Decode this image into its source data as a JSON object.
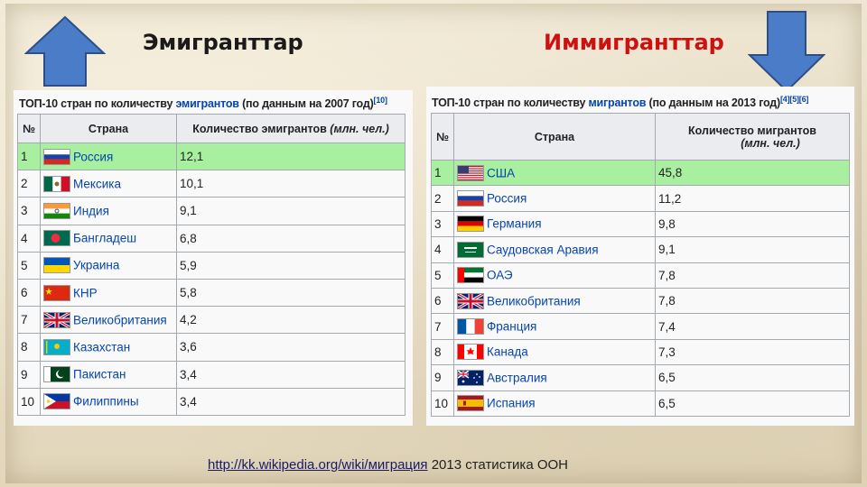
{
  "headings": {
    "left": "Эмигранттар",
    "right": "Иммигранттар"
  },
  "colors": {
    "arrow_fill": "#4a7cc7",
    "arrow_stroke": "#2d4f86",
    "highlight_row": "#a8f0a0",
    "link": "#0645ad",
    "right_heading": "#cc1111"
  },
  "left_table": {
    "caption_pre": "ТОП-10 стран по количеству",
    "caption_link": "эмигрантов",
    "caption_post": "(по данным на 2007 год)",
    "caption_ref": "[10]",
    "col_num": "№",
    "col_country": "Страна",
    "col_value": "Количество эмигрантов",
    "col_value_unit": "(млн. чел.)",
    "rows": [
      {
        "n": "1",
        "country": "Россия",
        "value": "12,1",
        "flag": "russia"
      },
      {
        "n": "2",
        "country": "Мексика",
        "value": "10,1",
        "flag": "mexico"
      },
      {
        "n": "3",
        "country": "Индия",
        "value": "9,1",
        "flag": "india"
      },
      {
        "n": "4",
        "country": "Бангладеш",
        "value": "6,8",
        "flag": "bangladesh"
      },
      {
        "n": "5",
        "country": "Украина",
        "value": "5,9",
        "flag": "ukraine"
      },
      {
        "n": "6",
        "country": "КНР",
        "value": "5,8",
        "flag": "china"
      },
      {
        "n": "7",
        "country": "Великобритания",
        "value": "4,2",
        "flag": "uk"
      },
      {
        "n": "8",
        "country": "Казахстан",
        "value": "3,6",
        "flag": "kazakhstan"
      },
      {
        "n": "9",
        "country": "Пакистан",
        "value": "3,4",
        "flag": "pakistan"
      },
      {
        "n": "10",
        "country": "Филиппины",
        "value": "3,4",
        "flag": "philippines"
      }
    ]
  },
  "right_table": {
    "caption_pre": "ТОП-10 стран по количеству",
    "caption_link": "мигрантов",
    "caption_post": "(по данным на 2013 год)",
    "caption_ref": "[4][5][6]",
    "col_num": "№",
    "col_country": "Страна",
    "col_value": "Количество мигрантов",
    "col_value_unit": "(млн. чел.)",
    "rows": [
      {
        "n": "1",
        "country": "США",
        "value": "45,8",
        "flag": "usa"
      },
      {
        "n": "2",
        "country": "Россия",
        "value": "11,2",
        "flag": "russia"
      },
      {
        "n": "3",
        "country": "Германия",
        "value": "9,8",
        "flag": "germany"
      },
      {
        "n": "4",
        "country": "Саудовская Аравия",
        "value": "9,1",
        "flag": "saudi"
      },
      {
        "n": "5",
        "country": "ОАЭ",
        "value": "7,8",
        "flag": "uae"
      },
      {
        "n": "6",
        "country": "Великобритания",
        "value": "7,8",
        "flag": "uk"
      },
      {
        "n": "7",
        "country": "Франция",
        "value": "7,4",
        "flag": "france"
      },
      {
        "n": "8",
        "country": "Канада",
        "value": "7,3",
        "flag": "canada"
      },
      {
        "n": "9",
        "country": "Австралия",
        "value": "6,5",
        "flag": "australia"
      },
      {
        "n": "10",
        "country": "Испания",
        "value": "6,5",
        "flag": "spain"
      }
    ]
  },
  "footer": {
    "url": "http://kk.wikipedia.org/wiki/миграция",
    "text": "2013 статистика ООН"
  }
}
